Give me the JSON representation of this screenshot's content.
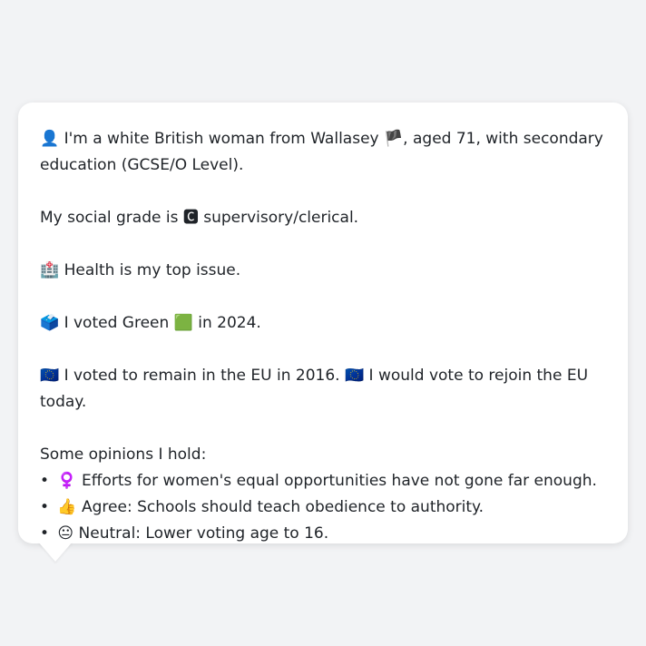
{
  "profile": {
    "intro": {
      "icon": "👤",
      "pre": "I'm a white British woman from Wallasey",
      "flag": "🏴",
      "post": ", aged 71, with secondary education (GCSE/O Level)."
    },
    "grade": {
      "pre": "My social grade is",
      "icon": "🅲",
      "post": "supervisory/clerical."
    },
    "issue": {
      "icon": "🏥",
      "text": "Health is my top issue."
    },
    "vote": {
      "icon": "🗳️",
      "pre": "I voted Green",
      "color_icon": "🟩",
      "post": "in 2024."
    },
    "eu": {
      "icon1": "🇪🇺",
      "text1": "I voted to remain in the EU in 2016.",
      "icon2": "🇪🇺",
      "text2": "I would vote to rejoin the EU today."
    },
    "opinions_heading": "Some opinions I hold:",
    "opinions": [
      {
        "bullet": "•",
        "icon": "♀️",
        "text": "Efforts for women's equal opportunities have not gone far enough."
      },
      {
        "bullet": "•",
        "icon": "👍",
        "text": "Agree: Schools should teach obedience to authority."
      },
      {
        "bullet": "•",
        "icon": "😐",
        "text": "Neutral: Lower voting age to 16."
      }
    ]
  },
  "colors": {
    "background": "#f2f3f5",
    "bubble": "#ffffff",
    "text": "#1f2328"
  }
}
